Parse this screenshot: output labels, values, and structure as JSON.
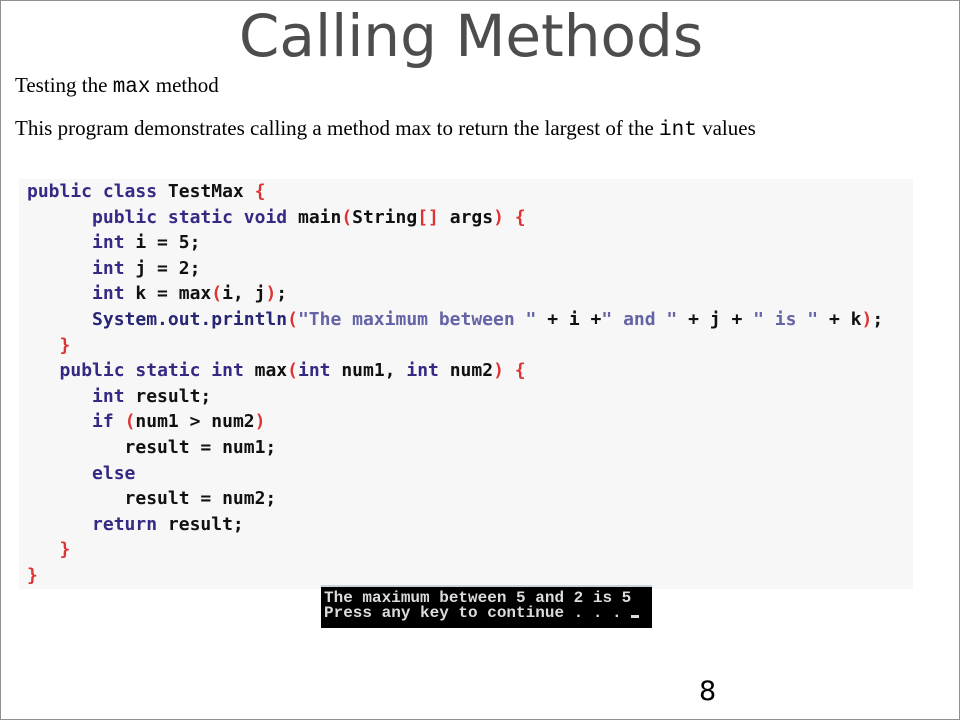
{
  "slide": {
    "title": "Calling Methods",
    "subtitle": {
      "before": "Testing the ",
      "code": "max",
      "after": " method"
    },
    "description": {
      "before": "This program demonstrates calling a method max to return the largest of the ",
      "code": "int",
      "after": " values"
    },
    "page_number": "8"
  },
  "code": {
    "lines": [
      [
        {
          "kw": "public"
        },
        {
          "t": " "
        },
        {
          "kw": "class"
        },
        {
          "t": " TestMax "
        },
        {
          "p": "{"
        }
      ],
      [
        {
          "t": "      "
        },
        {
          "kw": "public"
        },
        {
          "t": " "
        },
        {
          "kw": "static"
        },
        {
          "t": " "
        },
        {
          "kw": "void"
        },
        {
          "t": " main"
        },
        {
          "p": "("
        },
        {
          "t": "String"
        },
        {
          "p": "[]"
        },
        {
          "t": " args"
        },
        {
          "p": ")"
        },
        {
          "t": " "
        },
        {
          "p": "{"
        }
      ],
      [
        {
          "t": "      "
        },
        {
          "kw": "int"
        },
        {
          "t": " i = 5;"
        }
      ],
      [
        {
          "t": "      "
        },
        {
          "kw": "int"
        },
        {
          "t": " j = 2;"
        }
      ],
      [
        {
          "t": "      "
        },
        {
          "kw": "int"
        },
        {
          "t": " k = max"
        },
        {
          "p": "("
        },
        {
          "t": "i, j"
        },
        {
          "p": ")"
        },
        {
          "t": ";"
        }
      ],
      [
        {
          "t": "      "
        },
        {
          "id": "System.out.println"
        },
        {
          "p": "("
        },
        {
          "s": "\"The maximum between \""
        },
        {
          "t": " + i +"
        },
        {
          "s": "\" and \""
        },
        {
          "t": " + j + "
        },
        {
          "s": "\" is \""
        },
        {
          "t": " + k"
        },
        {
          "p": ")"
        },
        {
          "t": ";"
        }
      ],
      [
        {
          "t": "   "
        },
        {
          "p": "}"
        }
      ],
      [
        {
          "t": "   "
        },
        {
          "kw": "public"
        },
        {
          "t": " "
        },
        {
          "kw": "static"
        },
        {
          "t": " "
        },
        {
          "kw": "int"
        },
        {
          "t": " max"
        },
        {
          "p": "("
        },
        {
          "kw": "int"
        },
        {
          "t": " num1, "
        },
        {
          "kw": "int"
        },
        {
          "t": " num2"
        },
        {
          "p": ")"
        },
        {
          "t": " "
        },
        {
          "p": "{"
        }
      ],
      [
        {
          "t": "      "
        },
        {
          "kw": "int"
        },
        {
          "t": " result;"
        }
      ],
      [
        {
          "t": "      "
        },
        {
          "kw": "if"
        },
        {
          "t": " "
        },
        {
          "p": "("
        },
        {
          "t": "num1 > num2"
        },
        {
          "p": ")"
        }
      ],
      [
        {
          "t": "         result = num1;"
        }
      ],
      [
        {
          "t": "      "
        },
        {
          "kw": "else"
        }
      ],
      [
        {
          "t": "         result = num2;"
        }
      ],
      [
        {
          "t": "      "
        },
        {
          "kw": "return"
        },
        {
          "t": " result;"
        }
      ],
      [
        {
          "t": "   "
        },
        {
          "p": "}"
        }
      ],
      [
        {
          "p": "}"
        }
      ]
    ]
  },
  "console": {
    "lines": [
      "The maximum between 5 and 2 is 5",
      "Press any key to continue . . ."
    ]
  },
  "colors": {
    "title": "#4d4d4d",
    "keyword": "#342a84",
    "identifier": "#262673",
    "punctuation": "#dd3333",
    "string": "#6363a6",
    "plain": "#111111",
    "code_background": "#f7f7f7",
    "console_background": "#000000",
    "console_text": "#dcdcdc"
  }
}
